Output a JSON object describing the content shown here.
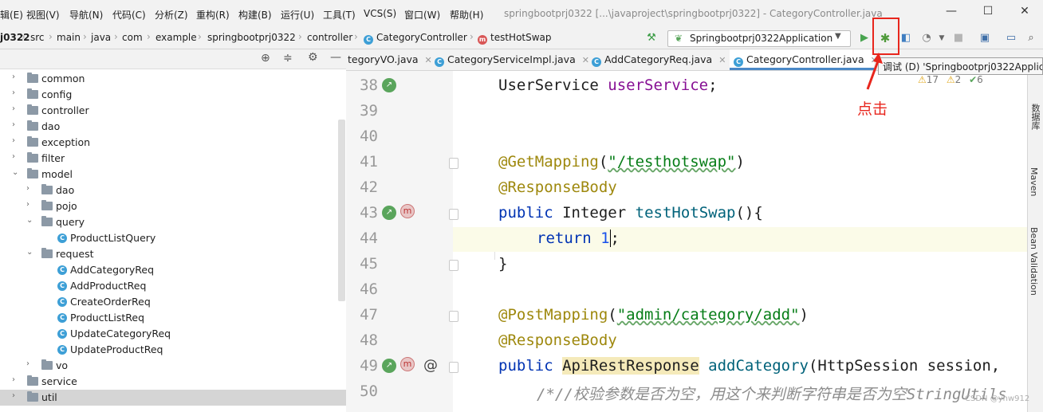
{
  "menubar": {
    "items": [
      "辑(E)",
      "视图(V)",
      "导航(N)",
      "代码(C)",
      "分析(Z)",
      "重构(R)",
      "构建(B)",
      "运行(U)",
      "工具(T)",
      "VCS(S)",
      "窗口(W)",
      "帮助(H)"
    ],
    "window_title": "springbootprj0322 [...\\javaproject\\springbootprj0322] - CategoryController.java"
  },
  "breadcrumb": [
    "j0322",
    "src",
    "main",
    "java",
    "com",
    "example",
    "springbootprj0322",
    "controller",
    "CategoryController",
    "testHotSwap"
  ],
  "run_config": "Springbootprj0322Application",
  "tooltip": "调试 (D) 'Springbootprj0322Applica",
  "annotation": "点击",
  "inspections": {
    "warnings": "17",
    "weak": "2",
    "ok": "6"
  },
  "tabs": [
    {
      "label": "tegoryVO.java",
      "active": false
    },
    {
      "label": "CategoryServiceImpl.java",
      "active": false
    },
    {
      "label": "AddCategoryReq.java",
      "active": false
    },
    {
      "label": "CategoryController.java",
      "active": true
    }
  ],
  "tree": [
    {
      "label": "common",
      "level": 1,
      "kind": "folder",
      "expanded": false
    },
    {
      "label": "config",
      "level": 1,
      "kind": "folder",
      "expanded": false
    },
    {
      "label": "controller",
      "level": 1,
      "kind": "folder",
      "expanded": false
    },
    {
      "label": "dao",
      "level": 1,
      "kind": "folder",
      "expanded": false
    },
    {
      "label": "exception",
      "level": 1,
      "kind": "folder",
      "expanded": false
    },
    {
      "label": "filter",
      "level": 1,
      "kind": "folder",
      "expanded": false
    },
    {
      "label": "model",
      "level": 1,
      "kind": "folder",
      "expanded": true
    },
    {
      "label": "dao",
      "level": 2,
      "kind": "folder",
      "expanded": false
    },
    {
      "label": "pojo",
      "level": 2,
      "kind": "folder",
      "expanded": false
    },
    {
      "label": "query",
      "level": 2,
      "kind": "folder",
      "expanded": true
    },
    {
      "label": "ProductListQuery",
      "level": 3,
      "kind": "class"
    },
    {
      "label": "request",
      "level": 2,
      "kind": "folder",
      "expanded": true
    },
    {
      "label": "AddCategoryReq",
      "level": 3,
      "kind": "class"
    },
    {
      "label": "AddProductReq",
      "level": 3,
      "kind": "class"
    },
    {
      "label": "CreateOrderReq",
      "level": 3,
      "kind": "class"
    },
    {
      "label": "ProductListReq",
      "level": 3,
      "kind": "class"
    },
    {
      "label": "UpdateCategoryReq",
      "level": 3,
      "kind": "class"
    },
    {
      "label": "UpdateProductReq",
      "level": 3,
      "kind": "class"
    },
    {
      "label": "vo",
      "level": 2,
      "kind": "folder",
      "expanded": false
    },
    {
      "label": "service",
      "level": 1,
      "kind": "folder",
      "expanded": false
    },
    {
      "label": "util",
      "level": 1,
      "kind": "folder",
      "expanded": false,
      "selected": true
    }
  ],
  "line_numbers": [
    "38",
    "39",
    "40",
    "41",
    "42",
    "43",
    "44",
    "45",
    "46",
    "47",
    "48",
    "49",
    "50"
  ],
  "code": {
    "l38_type": "UserService",
    "l38_field": "userService",
    "l38_end": ";",
    "l41_ann": "@GetMapping",
    "l41_str": "\"/testhotswap\"",
    "l42_ann": "@ResponseBody",
    "l43_kw": "public",
    "l43_type": "Integer",
    "l43_fn": "testHotSwap",
    "l43_end": "(){",
    "l44_kw": "return",
    "l44_num": "1",
    "l44_end": ";",
    "l45": "}",
    "l47_ann": "@PostMapping",
    "l47_str": "\"admin/category/add\"",
    "l48_ann": "@ResponseBody",
    "l49_kw": "public",
    "l49_type": "ApiRestResponse",
    "l49_fn": "addCategory",
    "l49_end": "(HttpSession session,",
    "l50_cmt": "/*//校验参数是否为空，用这个来判断字符串是否为空StringUtils"
  },
  "right_tools": [
    "数据库",
    "Maven",
    "Bean Validation"
  ],
  "watermark": "CSDN @yhw912"
}
